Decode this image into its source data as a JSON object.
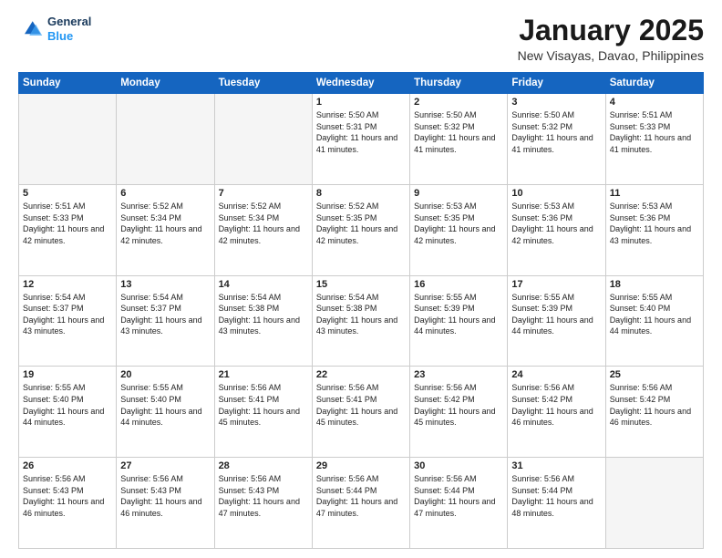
{
  "header": {
    "logo_line1": "General",
    "logo_line2": "Blue",
    "month": "January 2025",
    "location": "New Visayas, Davao, Philippines"
  },
  "weekdays": [
    "Sunday",
    "Monday",
    "Tuesday",
    "Wednesday",
    "Thursday",
    "Friday",
    "Saturday"
  ],
  "weeks": [
    [
      {
        "day": "",
        "empty": true
      },
      {
        "day": "",
        "empty": true
      },
      {
        "day": "",
        "empty": true
      },
      {
        "day": "1",
        "sunrise": "5:50 AM",
        "sunset": "5:31 PM",
        "daylight": "11 hours and 41 minutes."
      },
      {
        "day": "2",
        "sunrise": "5:50 AM",
        "sunset": "5:32 PM",
        "daylight": "11 hours and 41 minutes."
      },
      {
        "day": "3",
        "sunrise": "5:50 AM",
        "sunset": "5:32 PM",
        "daylight": "11 hours and 41 minutes."
      },
      {
        "day": "4",
        "sunrise": "5:51 AM",
        "sunset": "5:33 PM",
        "daylight": "11 hours and 41 minutes."
      }
    ],
    [
      {
        "day": "5",
        "sunrise": "5:51 AM",
        "sunset": "5:33 PM",
        "daylight": "11 hours and 42 minutes."
      },
      {
        "day": "6",
        "sunrise": "5:52 AM",
        "sunset": "5:34 PM",
        "daylight": "11 hours and 42 minutes."
      },
      {
        "day": "7",
        "sunrise": "5:52 AM",
        "sunset": "5:34 PM",
        "daylight": "11 hours and 42 minutes."
      },
      {
        "day": "8",
        "sunrise": "5:52 AM",
        "sunset": "5:35 PM",
        "daylight": "11 hours and 42 minutes."
      },
      {
        "day": "9",
        "sunrise": "5:53 AM",
        "sunset": "5:35 PM",
        "daylight": "11 hours and 42 minutes."
      },
      {
        "day": "10",
        "sunrise": "5:53 AM",
        "sunset": "5:36 PM",
        "daylight": "11 hours and 42 minutes."
      },
      {
        "day": "11",
        "sunrise": "5:53 AM",
        "sunset": "5:36 PM",
        "daylight": "11 hours and 43 minutes."
      }
    ],
    [
      {
        "day": "12",
        "sunrise": "5:54 AM",
        "sunset": "5:37 PM",
        "daylight": "11 hours and 43 minutes."
      },
      {
        "day": "13",
        "sunrise": "5:54 AM",
        "sunset": "5:37 PM",
        "daylight": "11 hours and 43 minutes."
      },
      {
        "day": "14",
        "sunrise": "5:54 AM",
        "sunset": "5:38 PM",
        "daylight": "11 hours and 43 minutes."
      },
      {
        "day": "15",
        "sunrise": "5:54 AM",
        "sunset": "5:38 PM",
        "daylight": "11 hours and 43 minutes."
      },
      {
        "day": "16",
        "sunrise": "5:55 AM",
        "sunset": "5:39 PM",
        "daylight": "11 hours and 44 minutes."
      },
      {
        "day": "17",
        "sunrise": "5:55 AM",
        "sunset": "5:39 PM",
        "daylight": "11 hours and 44 minutes."
      },
      {
        "day": "18",
        "sunrise": "5:55 AM",
        "sunset": "5:40 PM",
        "daylight": "11 hours and 44 minutes."
      }
    ],
    [
      {
        "day": "19",
        "sunrise": "5:55 AM",
        "sunset": "5:40 PM",
        "daylight": "11 hours and 44 minutes."
      },
      {
        "day": "20",
        "sunrise": "5:55 AM",
        "sunset": "5:40 PM",
        "daylight": "11 hours and 44 minutes."
      },
      {
        "day": "21",
        "sunrise": "5:56 AM",
        "sunset": "5:41 PM",
        "daylight": "11 hours and 45 minutes."
      },
      {
        "day": "22",
        "sunrise": "5:56 AM",
        "sunset": "5:41 PM",
        "daylight": "11 hours and 45 minutes."
      },
      {
        "day": "23",
        "sunrise": "5:56 AM",
        "sunset": "5:42 PM",
        "daylight": "11 hours and 45 minutes."
      },
      {
        "day": "24",
        "sunrise": "5:56 AM",
        "sunset": "5:42 PM",
        "daylight": "11 hours and 46 minutes."
      },
      {
        "day": "25",
        "sunrise": "5:56 AM",
        "sunset": "5:42 PM",
        "daylight": "11 hours and 46 minutes."
      }
    ],
    [
      {
        "day": "26",
        "sunrise": "5:56 AM",
        "sunset": "5:43 PM",
        "daylight": "11 hours and 46 minutes."
      },
      {
        "day": "27",
        "sunrise": "5:56 AM",
        "sunset": "5:43 PM",
        "daylight": "11 hours and 46 minutes."
      },
      {
        "day": "28",
        "sunrise": "5:56 AM",
        "sunset": "5:43 PM",
        "daylight": "11 hours and 47 minutes."
      },
      {
        "day": "29",
        "sunrise": "5:56 AM",
        "sunset": "5:44 PM",
        "daylight": "11 hours and 47 minutes."
      },
      {
        "day": "30",
        "sunrise": "5:56 AM",
        "sunset": "5:44 PM",
        "daylight": "11 hours and 47 minutes."
      },
      {
        "day": "31",
        "sunrise": "5:56 AM",
        "sunset": "5:44 PM",
        "daylight": "11 hours and 48 minutes."
      },
      {
        "day": "",
        "empty": true
      }
    ]
  ]
}
